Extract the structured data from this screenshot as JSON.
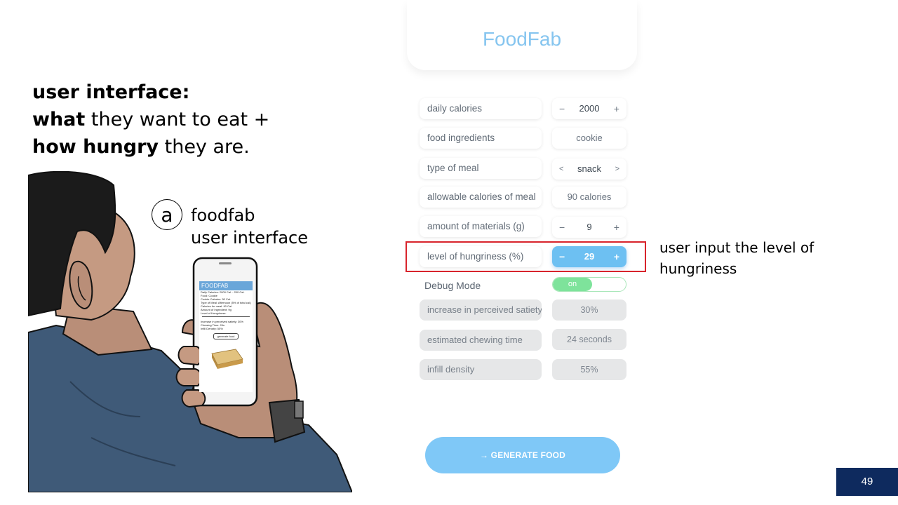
{
  "headline": {
    "line1_bold": "user interface:",
    "line2_bold": "what",
    "line2_rest": " they want to eat +",
    "line3_bold": "how hungry",
    "line3_rest": " they are."
  },
  "illustration": {
    "badge": "a",
    "label_line1": "foodfab",
    "label_line2": "user interface",
    "phone": {
      "header": "FOODFAB",
      "lines": [
        "Daily Calories: 2000 Cal. - 200 Cal.",
        "Food: Cookie",
        "Cookie Calories: 50 Cal.",
        "Type of Meal: Afternoon (5% of total cal.)",
        "Calories for meal: 90 Cal.",
        "Amount of Ingredient: 9g",
        "Level of Hungriness:",
        "",
        "Increase in perceived satiety: 30%",
        "Chewing Time: 24s",
        "Infill Density: 55%"
      ],
      "button": "generate food"
    }
  },
  "app": {
    "title": "FoodFab",
    "rows": [
      {
        "label": "daily calories",
        "kind": "stepper",
        "value": "2000",
        "minus": "−",
        "plus": "+"
      },
      {
        "label": "food ingredients",
        "kind": "text",
        "value": "cookie"
      },
      {
        "label": "type of meal",
        "kind": "select",
        "value": "snack",
        "prev": "<",
        "next": ">"
      },
      {
        "label": "allowable calories of meal",
        "kind": "text",
        "value": "90 calories"
      },
      {
        "label": "amount of materials (g)",
        "kind": "stepper",
        "value": "9",
        "minus": "−",
        "plus": "+"
      },
      {
        "label": "level of hungriness (%)",
        "kind": "stepper",
        "value": "29",
        "minus": "−",
        "plus": "+"
      }
    ],
    "debug": {
      "label": "Debug Mode",
      "state": "on"
    },
    "outputs": [
      {
        "label": "increase in perceived satiety",
        "value": "30%"
      },
      {
        "label": "estimated chewing time",
        "value": "24 seconds"
      },
      {
        "label": "infill density",
        "value": "55%"
      }
    ],
    "generate_label": "→  GENERATE FOOD"
  },
  "annotation": {
    "line1": "user input the level of",
    "line2": "hungriness"
  },
  "page_number": "49",
  "colors": {
    "accent": "#6dc0f2",
    "title": "#86c5ef",
    "highlight": "#d8242c",
    "toggle_on": "#7ee39b",
    "page_badge": "#0e2a5e"
  }
}
